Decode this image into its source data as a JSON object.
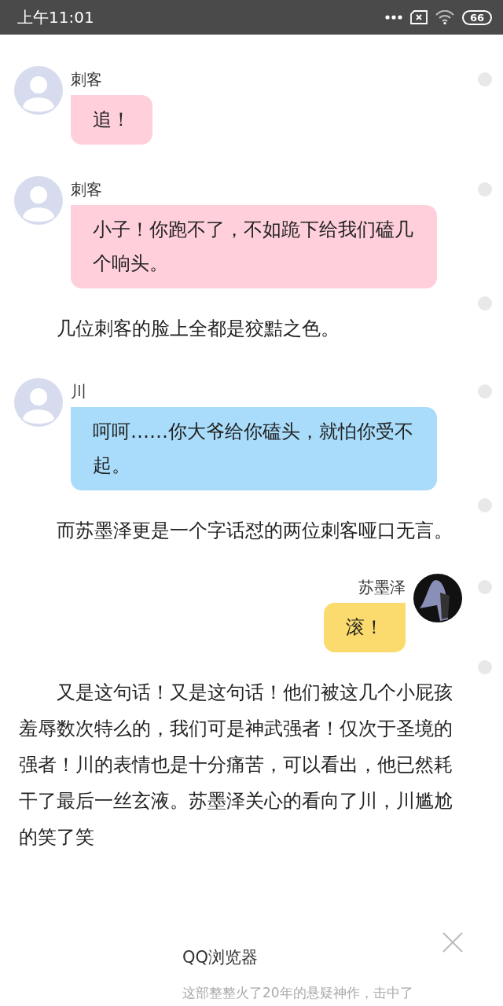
{
  "status_bar": {
    "time": "上午11:01",
    "battery": "66"
  },
  "messages": [
    {
      "kind": "left",
      "sender": "刺客",
      "text": "追！",
      "color": "#ffd0dc"
    },
    {
      "kind": "left",
      "sender": "刺客",
      "text": "小子！你跑不了，不如跪下给我们磕几个响头。",
      "color": "#ffd0dc"
    },
    {
      "kind": "narration",
      "text": "几位刺客的脸上全都是狡黠之色。"
    },
    {
      "kind": "left",
      "sender": "川",
      "text": "呵呵……你大爷给你磕头，就怕你受不起。",
      "color": "#a8dcfa"
    },
    {
      "kind": "narration",
      "text": "而苏墨泽更是一个字话怼的两位刺客哑口无言。"
    },
    {
      "kind": "right",
      "sender": "苏墨泽",
      "text": "滚！",
      "color": "#fcdb6e"
    },
    {
      "kind": "narration",
      "text": "又是这句话！又是这句话！他们被这几个小屁孩羞辱数次特么的，我们可是神武强者！仅次于圣境的强者！川的表情也是十分痛苦，可以看出，他已然耗干了最后一丝玄液。苏墨泽关心的看向了川，川尴尬的笑了笑"
    }
  ],
  "notification": {
    "app": "QQ浏览器",
    "text": "这部整整火了20年的悬疑神作，击中了"
  }
}
